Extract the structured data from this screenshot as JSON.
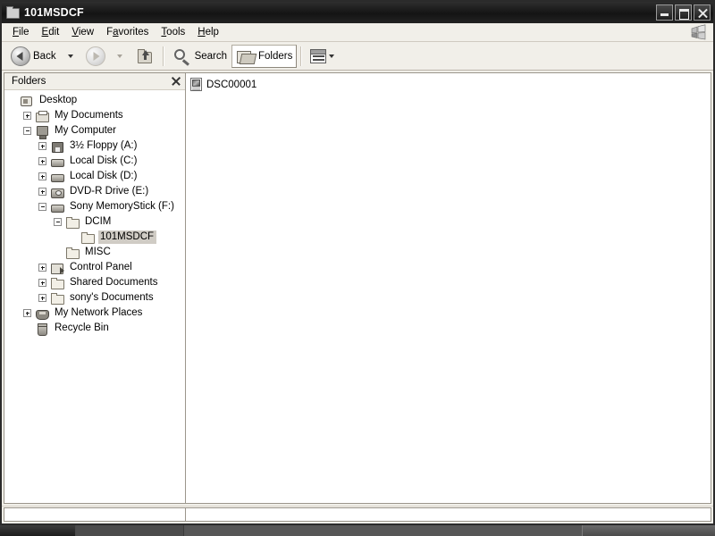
{
  "window": {
    "title": "101MSDCF",
    "title_icon": "folder-open-icon",
    "buttons": {
      "minimize": "Minimize",
      "maximize": "Maximize",
      "close": "Close"
    }
  },
  "menubar": {
    "items": [
      {
        "label": "File",
        "accel": "F"
      },
      {
        "label": "Edit",
        "accel": "E"
      },
      {
        "label": "View",
        "accel": "V"
      },
      {
        "label": "Favorites",
        "accel": "a"
      },
      {
        "label": "Tools",
        "accel": "T"
      },
      {
        "label": "Help",
        "accel": "H"
      }
    ],
    "brand_icon": "windows-flag-icon"
  },
  "toolbar": {
    "back": {
      "label": "Back",
      "icon": "back-arrow-icon",
      "enabled": true,
      "has_dropdown": true
    },
    "forward": {
      "label": "Forward",
      "icon": "forward-arrow-icon",
      "enabled": false,
      "has_dropdown": true
    },
    "up": {
      "label": "Up",
      "icon": "up-folder-icon",
      "enabled": true
    },
    "search": {
      "label": "Search",
      "icon": "magnifier-icon"
    },
    "folders": {
      "label": "Folders",
      "icon": "folders-icon",
      "pressed": true
    },
    "views": {
      "label": "Views",
      "icon": "views-icon",
      "has_dropdown": true
    }
  },
  "folders_pane": {
    "header": "Folders",
    "close_icon": "close-icon",
    "tree": [
      {
        "label": "Desktop",
        "indent": 0,
        "expander": "none",
        "icon": "desktop-icon",
        "selected": false
      },
      {
        "label": "My Documents",
        "indent": 1,
        "expander": "plus",
        "icon": "my-documents-icon",
        "selected": false
      },
      {
        "label": "My Computer",
        "indent": 1,
        "expander": "minus",
        "icon": "my-computer-icon",
        "selected": false
      },
      {
        "label": "3½ Floppy (A:)",
        "indent": 2,
        "expander": "plus",
        "icon": "floppy-drive-icon",
        "selected": false
      },
      {
        "label": "Local Disk (C:)",
        "indent": 2,
        "expander": "plus",
        "icon": "hard-disk-icon",
        "selected": false
      },
      {
        "label": "Local Disk (D:)",
        "indent": 2,
        "expander": "plus",
        "icon": "hard-disk-icon",
        "selected": false
      },
      {
        "label": "DVD-R Drive (E:)",
        "indent": 2,
        "expander": "plus",
        "icon": "dvd-drive-icon",
        "selected": false
      },
      {
        "label": "Sony MemoryStick (F:)",
        "indent": 2,
        "expander": "minus",
        "icon": "removable-disk-icon",
        "selected": false
      },
      {
        "label": "DCIM",
        "indent": 3,
        "expander": "minus",
        "icon": "folder-icon",
        "selected": false
      },
      {
        "label": "101MSDCF",
        "indent": 4,
        "expander": "none",
        "icon": "folder-icon",
        "selected": true
      },
      {
        "label": "MISC",
        "indent": 3,
        "expander": "none",
        "icon": "folder-icon",
        "selected": false
      },
      {
        "label": "Control Panel",
        "indent": 2,
        "expander": "plus",
        "icon": "control-panel-icon",
        "selected": false
      },
      {
        "label": "Shared Documents",
        "indent": 2,
        "expander": "plus",
        "icon": "folder-icon",
        "selected": false
      },
      {
        "label": "sony's Documents",
        "indent": 2,
        "expander": "plus",
        "icon": "folder-icon",
        "selected": false
      },
      {
        "label": "My Network Places",
        "indent": 1,
        "expander": "plus",
        "icon": "network-icon",
        "selected": false
      },
      {
        "label": "Recycle Bin",
        "indent": 1,
        "expander": "none",
        "icon": "recycle-bin-icon",
        "selected": false
      }
    ]
  },
  "file_pane": {
    "items": [
      {
        "label": "DSC00001",
        "icon": "image-file-icon",
        "selected": false
      }
    ]
  },
  "statusbar": {
    "left": "",
    "right": ""
  },
  "colors": {
    "titlebar": "#141414",
    "chrome": "#f1efe9",
    "pane_background": "#ffffff",
    "selection": "#d0ccc5",
    "border": "#9b968c"
  }
}
